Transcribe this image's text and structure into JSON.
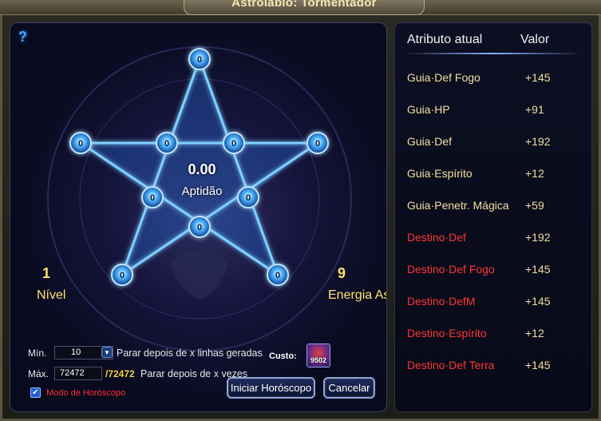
{
  "window": {
    "title": "Astrolábio: Tormentador"
  },
  "left": {
    "help_icon": "?",
    "aptitude": {
      "value": "0.00",
      "label": "Aptidão"
    },
    "level": {
      "value": "1",
      "label": "Nível"
    },
    "energy": {
      "value": "9",
      "label": "Energia Astral"
    },
    "nodes": [
      "0",
      "0",
      "0",
      "0",
      "0",
      "0",
      "0",
      "0",
      "0",
      "0"
    ],
    "controls": {
      "min_label": "Mín.",
      "min_value": "10",
      "min_hint": "Parar depois de x linhas geradas",
      "max_label": "Máx.",
      "max_value": "72472",
      "max_total": "/72472",
      "max_hint": "Parar depois de x vezes",
      "cost_label": "Custo:",
      "cost_value": "9502",
      "checkbox_label": "Modo de Horóscopo",
      "checkbox_checked": true,
      "start_button": "Iniciar Horóscopo",
      "cancel_button": "Cancelar"
    }
  },
  "right": {
    "header_attr": "Atributo atual",
    "header_value": "Valor",
    "rows": [
      {
        "prefix": "Guia",
        "name": "Def Fogo",
        "value": "+145",
        "type": "guia"
      },
      {
        "prefix": "Guia",
        "name": "HP",
        "value": "+91",
        "type": "guia"
      },
      {
        "prefix": "Guia",
        "name": "Def",
        "value": "+192",
        "type": "guia"
      },
      {
        "prefix": "Guia",
        "name": "Espírito",
        "value": "+12",
        "type": "guia"
      },
      {
        "prefix": "Guia",
        "name": "Penetr. Mágica",
        "value": "+59",
        "type": "guia"
      },
      {
        "prefix": "Destino",
        "name": "Def",
        "value": "+192",
        "type": "destino"
      },
      {
        "prefix": "Destino",
        "name": "Def Fogo",
        "value": "+145",
        "type": "destino"
      },
      {
        "prefix": "Destino",
        "name": "DefM",
        "value": "+145",
        "type": "destino"
      },
      {
        "prefix": "Destino",
        "name": "Espírito",
        "value": "+12",
        "type": "destino"
      },
      {
        "prefix": "Destino",
        "name": "Def Terra",
        "value": "+145",
        "type": "destino"
      }
    ]
  },
  "colors": {
    "guia": "#f3dfa0",
    "destino": "#ff3535",
    "accent": "#ffe36b",
    "star_glow": "#3fa6ff"
  }
}
